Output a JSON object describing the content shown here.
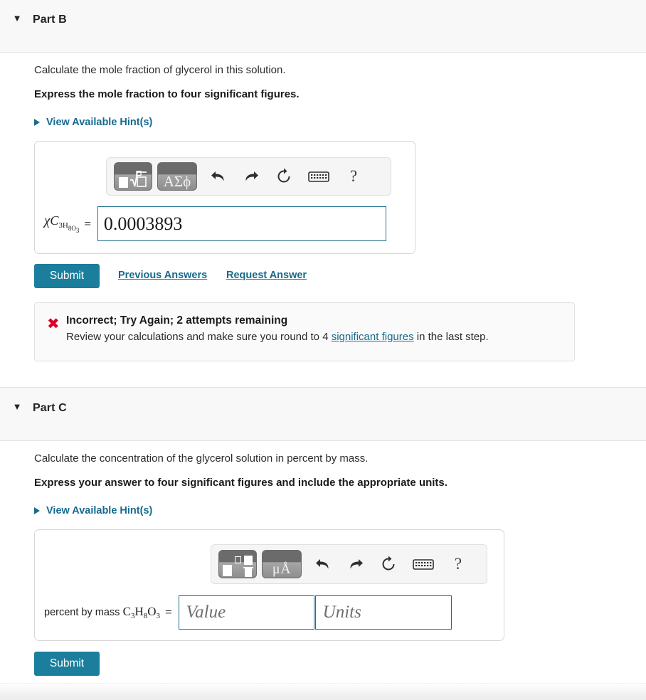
{
  "partB": {
    "header_label": "Part B",
    "caret": "▼",
    "question": "Calculate the mole fraction of glycerol in this solution.",
    "instruction": "Express the mole fraction to four significant figures.",
    "hints_label": "View Available Hint(s)",
    "toolbar": {
      "template_button": "square-root-template",
      "greek_button": "ΑΣϕ",
      "undo": "undo-arrow",
      "redo": "redo-arrow",
      "reset": "reset-circular-arrow",
      "keyboard": "keyboard",
      "help": "?"
    },
    "answer_label_chi": "χ",
    "answer_label_var": "C",
    "answer_label_sub": "3H",
    "answer_label_subsub": "8O",
    "answer_label_subsubsub": "3",
    "equals": "=",
    "answer_value": "0.0003893",
    "submit_label": "Submit",
    "previous_answers_label": "Previous Answers",
    "request_answer_label": "Request Answer",
    "feedback": {
      "icon": "✖",
      "title": "Incorrect; Try Again; 2 attempts remaining",
      "body_before": "Review your calculations and make sure you round to 4 ",
      "body_link": "significant figures",
      "body_after": " in the last step."
    }
  },
  "partC": {
    "header_label": "Part C",
    "caret": "▼",
    "question": "Calculate the concentration of the glycerol solution in percent by mass.",
    "instruction": "Express your answer to four significant figures and include the appropriate units.",
    "hints_label": "View Available Hint(s)",
    "toolbar": {
      "template_button": "fraction-template",
      "units_button": "μÅ",
      "undo": "undo-arrow",
      "redo": "redo-arrow",
      "reset": "reset-circular-arrow",
      "keyboard": "keyboard",
      "help": "?"
    },
    "answer_label_text": "percent by mass",
    "answer_label_formula_c": "C",
    "answer_label_formula_c_sub": "3",
    "answer_label_formula_h": "H",
    "answer_label_formula_h_sub": "8",
    "answer_label_formula_o": "O",
    "answer_label_formula_o_sub": "3",
    "equals": "=",
    "value_placeholder": "Value",
    "units_placeholder": "Units",
    "submit_label": "Submit"
  },
  "colors": {
    "accent_teal": "#1a7e9c",
    "link_teal": "#176a8c",
    "error_red": "#d80027",
    "header_bg": "#f8f8f8",
    "input_border": "#1d6f8e"
  }
}
